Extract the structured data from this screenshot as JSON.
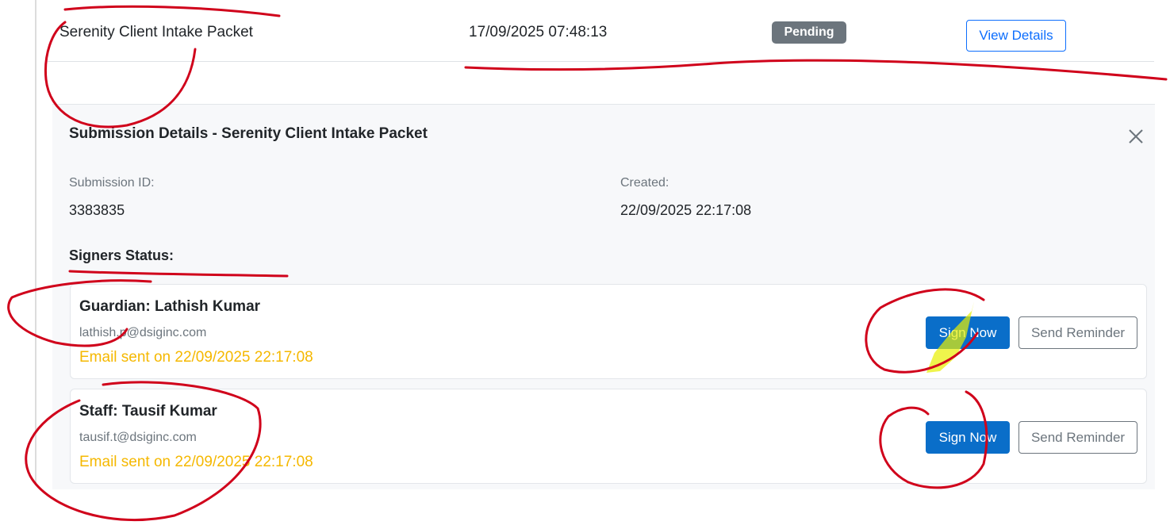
{
  "row": {
    "name": "Serenity Client Intake Packet",
    "date": "17/09/2025 07:48:13",
    "status": "Pending",
    "view_details_label": "View Details"
  },
  "details": {
    "title": "Submission Details - Serenity Client Intake Packet",
    "close_icon": "close-icon",
    "submission_id_label": "Submission ID:",
    "submission_id": "3383835",
    "created_label": "Created:",
    "created": "22/09/2025 22:17:08",
    "signers_title": "Signers Status:",
    "signers": [
      {
        "name": "Guardian: Lathish Kumar",
        "email": "lathish.p@dsiginc.com",
        "sent": "Email sent on 22/09/2025 22:17:08",
        "sign_label": "Sign Now",
        "remind_label": "Send Reminder"
      },
      {
        "name": "Staff: Tausif Kumar",
        "email": "tausif.t@dsiginc.com",
        "sent": "Email sent on 22/09/2025 22:17:08",
        "sign_label": "Sign Now",
        "remind_label": "Send Reminder"
      }
    ]
  },
  "colors": {
    "primary": "#0a6ec9",
    "badge": "#6c757d",
    "warning_text": "#f5b800",
    "annotation": "#d0021b",
    "highlighter": "#f0f000"
  }
}
